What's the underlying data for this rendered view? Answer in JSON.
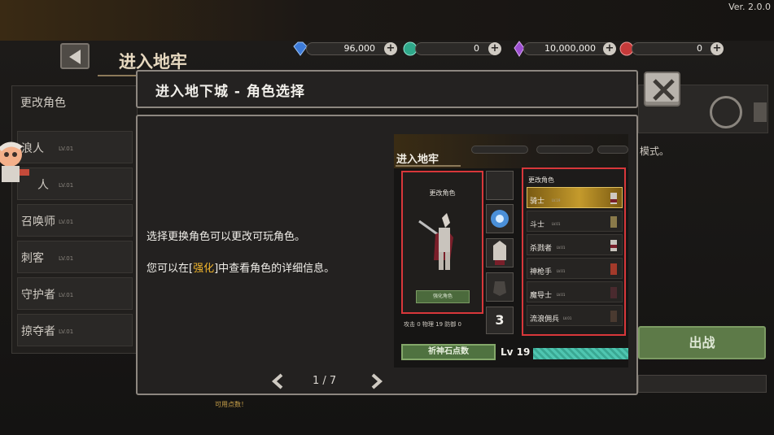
{
  "version": "Ver. 2.0.0",
  "resources": [
    {
      "icon": "blue-gem-icon",
      "value": "96,000",
      "color": "#3d7bd8"
    },
    {
      "icon": "green-gem-icon",
      "value": "0",
      "color": "#2fa88a"
    },
    {
      "icon": "purple-crystal-icon",
      "value": "10,000,000",
      "color": "#9d4fd1"
    },
    {
      "icon": "red-orb-icon",
      "value": "0",
      "color": "#c63a3a"
    }
  ],
  "background": {
    "screen_title": "进入地牢",
    "left_panel_header": "更改角色",
    "roles": [
      {
        "name": "浪人",
        "lv": "LV.01"
      },
      {
        "name": "人",
        "lv": "LV.01"
      },
      {
        "name": "召唤师",
        "lv": "LV.01"
      },
      {
        "name": "刺客",
        "lv": "LV.01"
      },
      {
        "name": "守护者",
        "lv": "LV.01"
      },
      {
        "name": "掠夺者",
        "lv": "LV.01"
      }
    ],
    "mode_text": "模式。",
    "sortie_label": "出战",
    "points_text": "可用点数！"
  },
  "modal": {
    "title": "进入地下城 - 角色选择",
    "desc1": "选择更换角色可以更改可玩角色。",
    "desc2_before": "您可以在[",
    "desc2_highlight": "强化",
    "desc2_after": "]中查看角色的详细信息。",
    "page": "1 / 7",
    "highlight_color": "#f0b52c"
  },
  "preview": {
    "title": "进入地牢",
    "left_header": "更改角色",
    "enhance_button": "强化角色",
    "slot_count": "3",
    "stats": "攻击  0  物理  19  防御  0",
    "right_header": "更改角色",
    "roles": [
      {
        "name": "骑士",
        "lv": "LV.19",
        "selected": true
      },
      {
        "name": "斗士",
        "lv": "LV.01",
        "selected": false
      },
      {
        "name": "杀戮者",
        "lv": "LV.01",
        "selected": false
      },
      {
        "name": "神枪手",
        "lv": "LV.01",
        "selected": false
      },
      {
        "name": "魔导士",
        "lv": "LV.01",
        "selected": false
      },
      {
        "name": "流浪佣兵",
        "lv": "LV.01",
        "selected": false
      }
    ],
    "bottom_button": "祈神石点数",
    "level": "Lv 19",
    "frame_color": "#d8373a"
  }
}
